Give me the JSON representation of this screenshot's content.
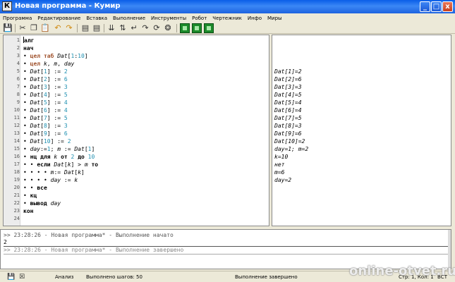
{
  "window": {
    "title": "Новая программа - Кумир",
    "icon_letter": "К",
    "min": "_",
    "max": "□",
    "close": "x"
  },
  "menu": [
    "Программа",
    "Редактирование",
    "Вставка",
    "Выполнение",
    "Инструменты",
    "Робот",
    "Чертежник",
    "Инфо",
    "Миры"
  ],
  "toolbar": {
    "icons": [
      "save-icon",
      "cut-icon",
      "copy-icon",
      "paste-icon",
      "undo-icon",
      "redo-icon",
      "indent-icon",
      "outdent-icon",
      "step-icon",
      "step-over-icon",
      "step-into-icon",
      "step-out-icon",
      "run-icon",
      "stop-icon",
      "robot-icon",
      "grid-icon",
      "drawer-icon"
    ]
  },
  "editor": {
    "lines": [
      {
        "n": "1",
        "text": "алг"
      },
      {
        "n": "2",
        "text": "нач"
      },
      {
        "n": "3",
        "text": "• цел таб Dat[1:10]"
      },
      {
        "n": "4",
        "text": "• цел k, m, day"
      },
      {
        "n": "5",
        "text": "• Dat[1] := 2"
      },
      {
        "n": "6",
        "text": "• Dat[2] := 6"
      },
      {
        "n": "7",
        "text": "• Dat[3] := 3"
      },
      {
        "n": "8",
        "text": "• Dat[4] := 5"
      },
      {
        "n": "9",
        "text": "• Dat[5] := 4"
      },
      {
        "n": "10",
        "text": "• Dat[6] := 4"
      },
      {
        "n": "11",
        "text": "• Dat[7] := 5"
      },
      {
        "n": "12",
        "text": "• Dat[8] := 3"
      },
      {
        "n": "13",
        "text": "• Dat[9] := 6"
      },
      {
        "n": "14",
        "text": "• Dat[10] := 2"
      },
      {
        "n": "15",
        "text": "• day:=1; m := Dat[1]"
      },
      {
        "n": "16",
        "text": "• нц для k от 2 до 10"
      },
      {
        "n": "17",
        "text": "• • если Dat[k] > m то"
      },
      {
        "n": "18",
        "text": "• • • • m:= Dat[k]"
      },
      {
        "n": "19",
        "text": "• • • • day := k"
      },
      {
        "n": "20",
        "text": "• • все"
      },
      {
        "n": "21",
        "text": "• кц"
      },
      {
        "n": "22",
        "text": "• вывод day"
      },
      {
        "n": "23",
        "text": "кон"
      },
      {
        "n": "24",
        "text": ""
      }
    ]
  },
  "output_pane": {
    "lines": [
      "Dat[1]=2",
      "Dat[2]=6",
      "Dat[3]=3",
      "Dat[4]=5",
      "Dat[5]=4",
      "Dat[6]=4",
      "Dat[7]=5",
      "Dat[8]=3",
      "Dat[9]=6",
      "Dat[10]=2",
      "day=1; m=2",
      "k=10",
      "нет",
      "m=6",
      "day=2"
    ]
  },
  "console": {
    "line1": ">> 23:28:26 - Новая программа* - Выполнение начато",
    "line2": "2",
    "line3": ">> 23:28:26 - Новая программа* - Выполнение завершено"
  },
  "status": {
    "mode": "Анализ",
    "steps": "Выполнено шагов: 50",
    "state": "Выполнение завершено",
    "position": "Стр: 1, Кол: 1",
    "layout": "ВСТ"
  },
  "watermark": "online-otvet.ru"
}
